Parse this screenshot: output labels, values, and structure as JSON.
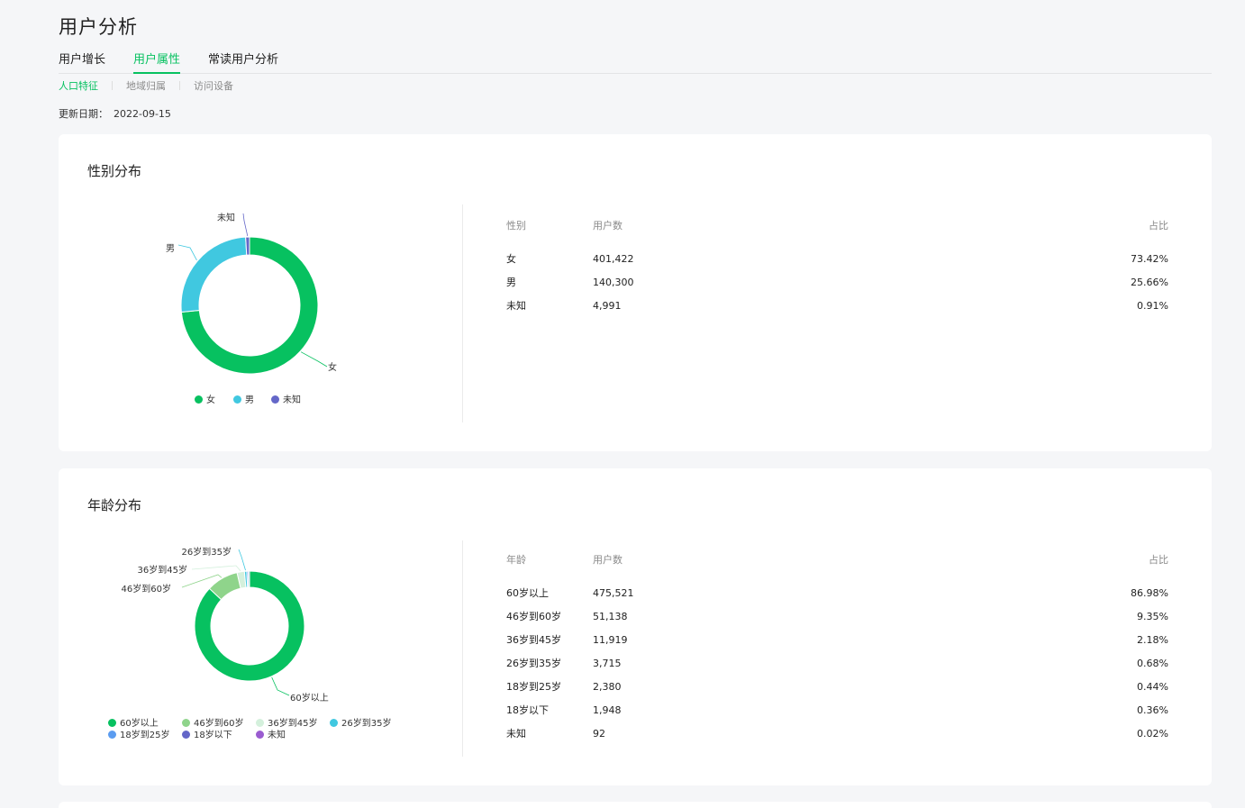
{
  "page": {
    "title": "用户分析"
  },
  "main_tabs": [
    {
      "label": "用户增长",
      "active": false
    },
    {
      "label": "用户属性",
      "active": true
    },
    {
      "label": "常读用户分析",
      "active": false
    }
  ],
  "sub_tabs": [
    {
      "label": "人口特征",
      "active": true
    },
    {
      "label": "地域归属",
      "active": false
    },
    {
      "label": "访问设备",
      "active": false
    }
  ],
  "update": {
    "label": "更新日期：",
    "date": "2022-09-15"
  },
  "gender": {
    "title": "性别分布",
    "table": {
      "headers": [
        "性别",
        "用户数",
        "占比"
      ],
      "rows": [
        [
          "女",
          "401,422",
          "73.42%"
        ],
        [
          "男",
          "140,300",
          "25.66%"
        ],
        [
          "未知",
          "4,991",
          "0.91%"
        ]
      ]
    }
  },
  "age": {
    "title": "年龄分布",
    "table": {
      "headers": [
        "年龄",
        "用户数",
        "占比"
      ],
      "rows": [
        [
          "60岁以上",
          "475,521",
          "86.98%"
        ],
        [
          "46岁到60岁",
          "51,138",
          "9.35%"
        ],
        [
          "36岁到45岁",
          "11,919",
          "2.18%"
        ],
        [
          "26岁到35岁",
          "3,715",
          "0.68%"
        ],
        [
          "18岁到25岁",
          "2,380",
          "0.44%"
        ],
        [
          "18岁以下",
          "1,948",
          "0.36%"
        ],
        [
          "未知",
          "92",
          "0.02%"
        ]
      ]
    }
  },
  "chart_data": [
    {
      "type": "pie",
      "title": "性别分布",
      "categories": [
        "女",
        "男",
        "未知"
      ],
      "values": [
        401422,
        140300,
        4991
      ],
      "percent": [
        73.42,
        25.66,
        0.91
      ],
      "colors": [
        "#07c160",
        "#40c8e0",
        "#6467c8"
      ],
      "labels_shown": [
        "女",
        "男",
        "未知"
      ],
      "legend": "bottom"
    },
    {
      "type": "pie",
      "title": "年龄分布",
      "categories": [
        "60岁以上",
        "46岁到60岁",
        "36岁到45岁",
        "26岁到35岁",
        "18岁到25岁",
        "18岁以下",
        "未知"
      ],
      "values": [
        475521,
        51138,
        11919,
        3715,
        2380,
        1948,
        92
      ],
      "percent": [
        86.98,
        9.35,
        2.18,
        0.68,
        0.44,
        0.36,
        0.02
      ],
      "colors": [
        "#07c160",
        "#8fd48b",
        "#d4f0dc",
        "#40c8e0",
        "#5b9cf0",
        "#6467c8",
        "#9a5cd0"
      ],
      "labels_shown": [
        "60岁以上",
        "46岁到60岁",
        "36岁到45岁",
        "26岁到35岁"
      ],
      "legend": "bottom"
    }
  ]
}
